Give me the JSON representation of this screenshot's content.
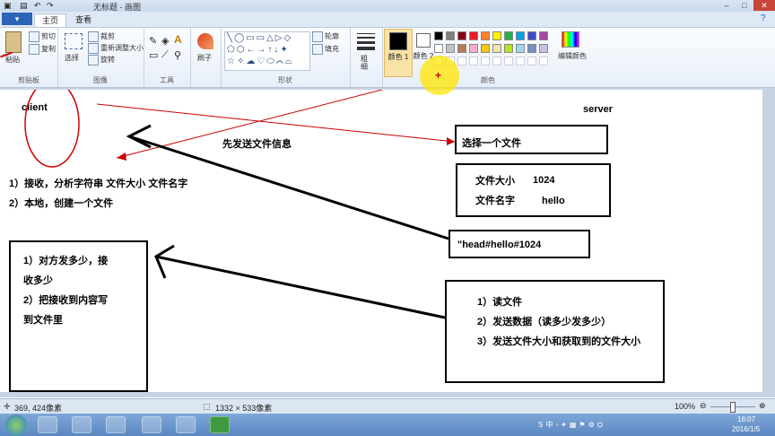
{
  "window": {
    "title": "无标题 - 画图"
  },
  "tabs": {
    "file": "▾",
    "home": "主页",
    "view": "查看"
  },
  "ribbon": {
    "clipboard": {
      "paste": "粘贴",
      "cut": "剪切",
      "copy": "复制",
      "label": "剪贴板"
    },
    "image": {
      "select": "选择",
      "crop": "裁剪",
      "resize": "重新调整大小",
      "rotate": "旋转",
      "label": "图像"
    },
    "tools": {
      "label": "工具"
    },
    "brush": {
      "label": "刷子"
    },
    "shapes": {
      "outline": "轮廓",
      "fill": "填充",
      "label": "形状"
    },
    "size": {
      "label": "粗细"
    },
    "colors": {
      "color1": "颜色 1",
      "color2": "颜色 2",
      "edit": "编辑颜色",
      "label": "颜色",
      "palette_row1": [
        "#000000",
        "#7f7f7f",
        "#880015",
        "#ed1c24",
        "#ff7f27",
        "#fff200",
        "#22b14c",
        "#00a2e8",
        "#3f48cc",
        "#a349a4"
      ],
      "palette_row2": [
        "#ffffff",
        "#c3c3c3",
        "#b97a57",
        "#ffaec9",
        "#ffc90e",
        "#efe4b0",
        "#b5e61d",
        "#99d9ea",
        "#7092be",
        "#c8bfe7"
      ]
    }
  },
  "canvas": {
    "client": "client",
    "server": "server",
    "send_info": "先发送文件信息",
    "client_step1": "1）接收，分析字符串  文件大小 文件名字",
    "client_step2": "2）本地，创建一个文件",
    "select_file": "选择一个文件",
    "file_size_label": "文件大小",
    "file_size_value": "1024",
    "file_name_label": "文件名字",
    "file_name_value": "hello",
    "head_string": "\"head#hello#1024",
    "left_box_line1": "1）对方发多少，接",
    "left_box_line2": "收多少",
    "left_box_line3": "2）把接收到内容写",
    "left_box_line4": "到文件里",
    "right_box_line1": "1）读文件",
    "right_box_line2": "2）发送数据（读多少发多少）",
    "right_box_line3": "3）发送文件大小和获取到的文件大小"
  },
  "status": {
    "cursor": "369, 424像素",
    "canvas_size": "1332 × 533像素",
    "zoom": "100%"
  },
  "taskbar": {
    "time": "16:07",
    "date": "2016/1/5"
  }
}
